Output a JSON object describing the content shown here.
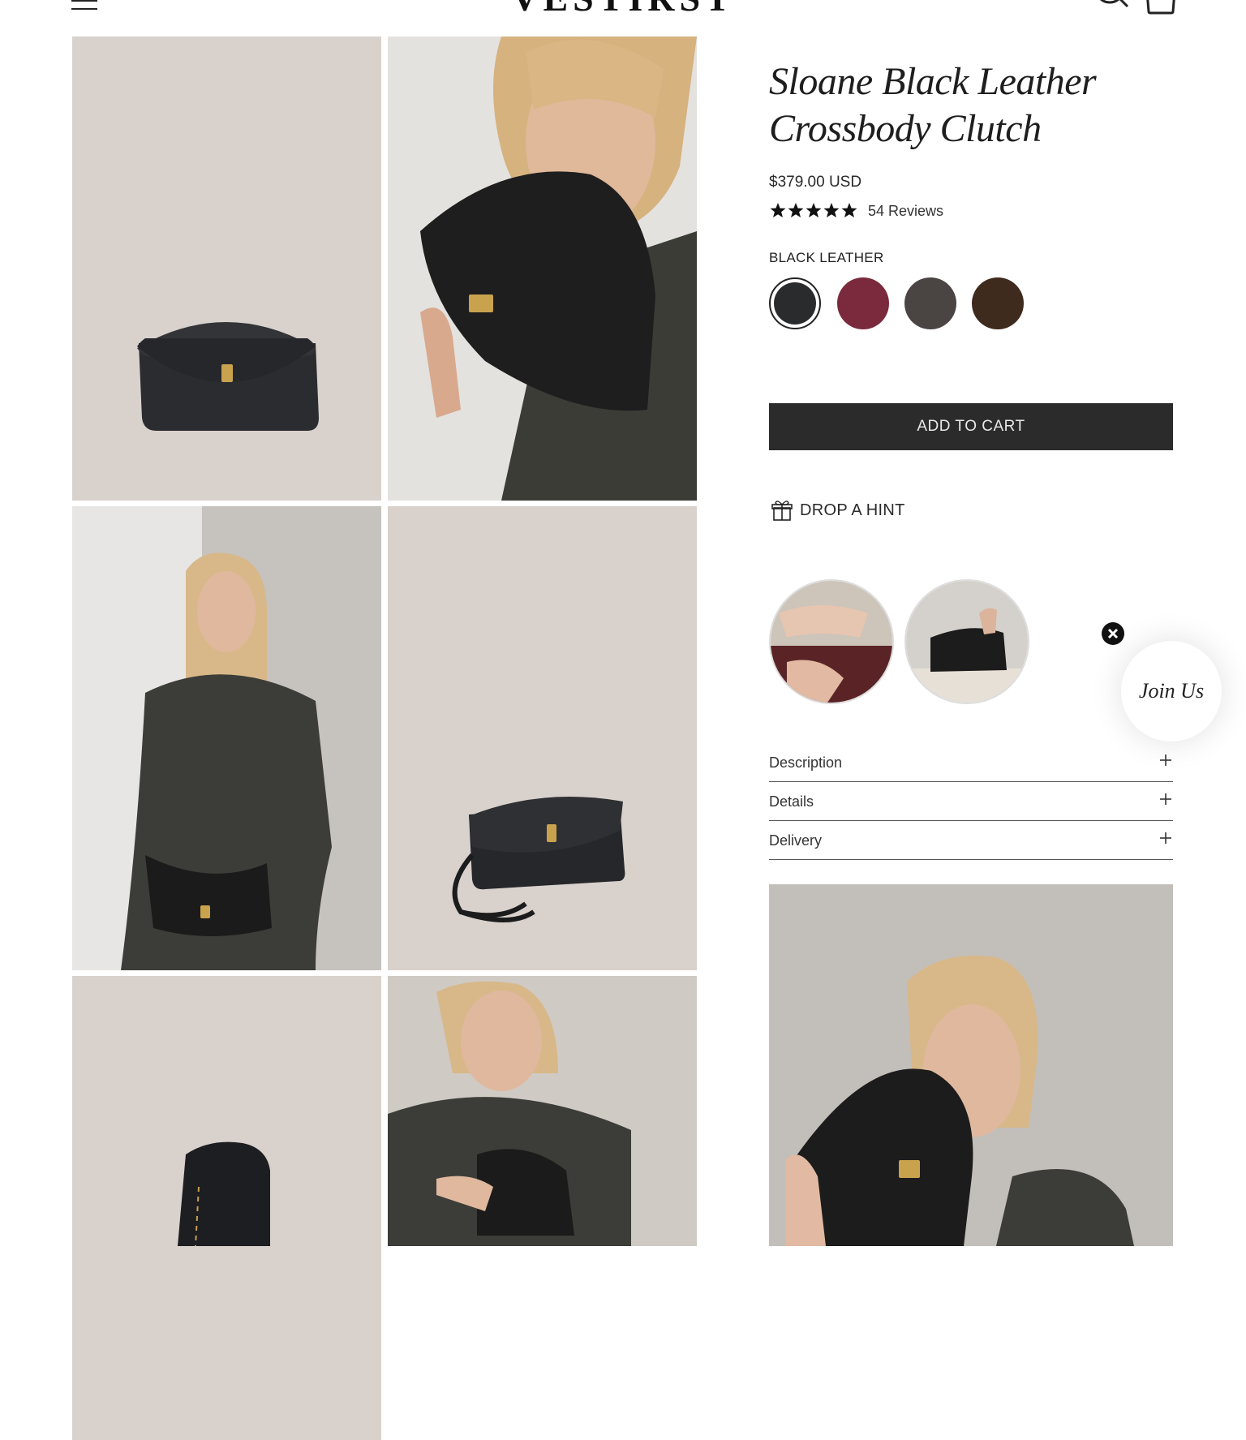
{
  "header": {
    "logo_text": "VESTIRST",
    "menu_icon": "hamburger-icon",
    "search_icon": "search-icon",
    "cart_icon": "bag-icon"
  },
  "gallery": {
    "images": [
      {
        "name": "product-image-front",
        "kind": "studio-product"
      },
      {
        "name": "model-image-holding-clutch",
        "kind": "model-photo"
      },
      {
        "name": "model-image-crossbody",
        "kind": "model-photo"
      },
      {
        "name": "product-image-strap",
        "kind": "studio-product"
      },
      {
        "name": "product-image-side",
        "kind": "studio-product"
      },
      {
        "name": "model-image-seated",
        "kind": "model-photo"
      }
    ]
  },
  "product": {
    "title_line1": "Sloane Black Leather",
    "title_line2": "Crossbody Clutch",
    "price": "$379.00 USD",
    "rating": 5,
    "reviews": "54 Reviews",
    "color_label": "BLACK LEATHER",
    "swatches": [
      {
        "name": "black",
        "color": "#2a2b2d",
        "selected": true
      },
      {
        "name": "burgundy",
        "color": "#7a2a3c",
        "selected": false
      },
      {
        "name": "charcoal",
        "color": "#4a4443",
        "selected": false
      },
      {
        "name": "chocolate",
        "color": "#3f2a1e",
        "selected": false
      }
    ],
    "add_to_cart": "ADD TO CART",
    "drop_hint": "DROP A HINT"
  },
  "popup": {
    "join_label": "Join Us"
  },
  "accordion": [
    {
      "label": "Description"
    },
    {
      "label": "Details"
    },
    {
      "label": "Delivery"
    }
  ],
  "colors": {
    "button_bg": "#2b2b2b",
    "tile_bg": "#d9d1cc",
    "text": "#2a2a2a"
  }
}
